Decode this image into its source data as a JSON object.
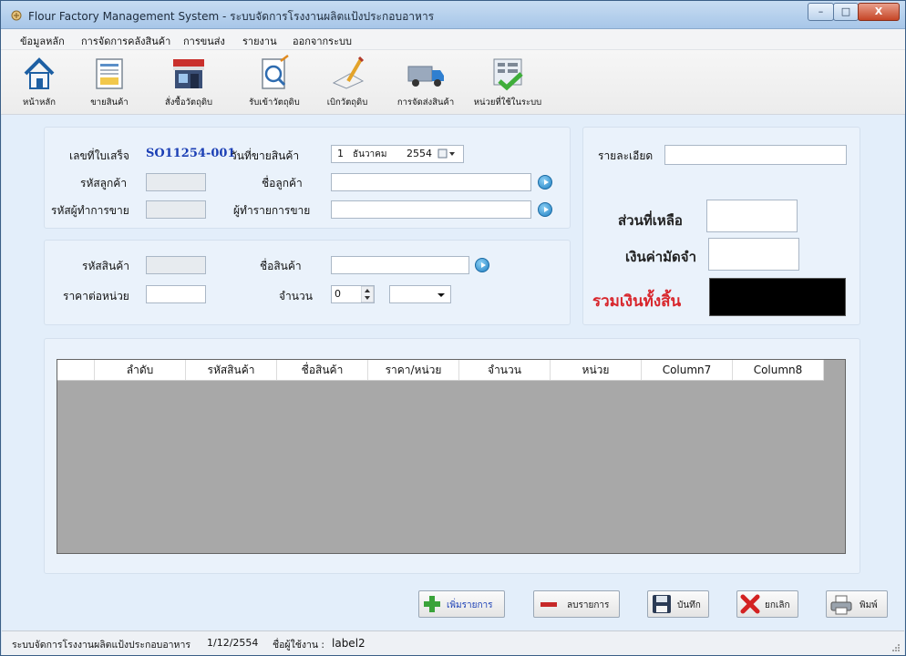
{
  "window": {
    "title": "Flour Factory Management System - ระบบจัดการโรงงานผลิตแป้งประกอบอาหาร",
    "minimize_glyph": "–",
    "maximize_glyph": "□",
    "close_glyph": "X"
  },
  "menu": [
    {
      "label": "ข้อมูลหลัก"
    },
    {
      "label": "การจัดการคลังสินค้า"
    },
    {
      "label": "การขนส่ง"
    },
    {
      "label": "รายงาน"
    },
    {
      "label": "ออกจากระบบ"
    }
  ],
  "toolbar": [
    {
      "label": "หน้าหลัก",
      "icon": "home-icon"
    },
    {
      "label": "ขายสินค้า",
      "icon": "sell-icon"
    },
    {
      "label": "สั่งซื้อวัตถุดิบ",
      "icon": "store-icon"
    },
    {
      "label": "รับเข้าวัตถุดิบ",
      "icon": "receive-icon"
    },
    {
      "label": "เบิกวัตถุดิบ",
      "icon": "withdraw-icon"
    },
    {
      "label": "การจัดส่งสินค้า",
      "icon": "truck-icon"
    },
    {
      "label": "หน่วยที่ใช้ในระบบ",
      "icon": "units-icon"
    }
  ],
  "invoice": {
    "receipt_label": "เลขที่ใบเสร็จ",
    "receipt_value": "SO11254-001",
    "sale_date_label": "วันที่ขายสินค้า",
    "sale_date_day": "1",
    "sale_date_month": "ธันวาคม",
    "sale_date_year": "2554",
    "customer_id_label": "รหัสลูกค้า",
    "customer_name_label": "ชื่อลูกค้า",
    "seller_id_label": "รหัสผู้ทำการขาย",
    "seller_name_label": "ผู้ทำรายการขาย"
  },
  "product": {
    "code_label": "รหัสสินค้า",
    "name_label": "ชื่อสินค้า",
    "price_label": "ราคาต่อหน่วย",
    "qty_label": "จำนวน",
    "qty_value": "0"
  },
  "summary": {
    "details_label": "รายละเอียด",
    "remaining_label": "ส่วนที่เหลือ",
    "deposit_label": "เงินค่ามัดจำ",
    "total_label": "รวมเงินทั้งสิ้น"
  },
  "grid": {
    "columns": [
      "ลำดับ",
      "รหัสสินค้า",
      "ชื่อสินค้า",
      "ราคา/หน่วย",
      "จำนวน",
      "หน่วย",
      "Column7",
      "Column8"
    ]
  },
  "actions": {
    "add_label": "เพิ่มรายการ",
    "remove_label": "ลบรายการ",
    "save_label": "บันทึก",
    "cancel_label": "ยกเลิก",
    "print_label": "พิมพ์"
  },
  "status": {
    "system_name": "ระบบจัดการโรงงานผลิตแป้งประกอบอาหาร",
    "date": "1/12/2554",
    "user_label": "ชื่อผู้ใช้งาน :",
    "user_value": "label2"
  },
  "colors": {
    "receipt_blue": "#1b3fb5",
    "total_red": "#d8262c",
    "total_box": "#000000"
  }
}
